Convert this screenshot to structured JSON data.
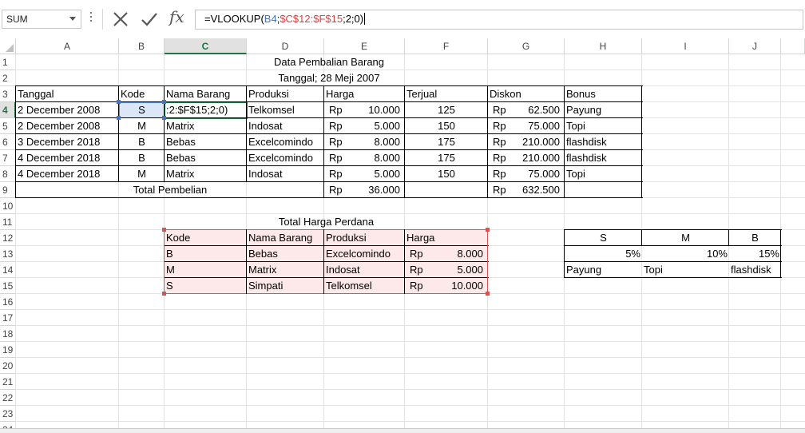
{
  "formula_bar": {
    "name_box": "SUM",
    "formula_prefix": "=VLOOKUP(",
    "formula_ref1": "B4",
    "formula_sep1": ";",
    "formula_ref2": "$C$12:$F$15",
    "formula_suffix": ";2;0)"
  },
  "columns": [
    "A",
    "B",
    "C",
    "D",
    "E",
    "F",
    "G",
    "H",
    "I",
    "J"
  ],
  "rows": [
    "1",
    "2",
    "3",
    "4",
    "5",
    "6",
    "7",
    "8",
    "9",
    "10",
    "11",
    "12",
    "13",
    "14",
    "15",
    "16",
    "17",
    "18",
    "19",
    "20",
    "21",
    "22",
    "23",
    "24"
  ],
  "sheet": {
    "title": "Data Pembalian Barang",
    "date_line": "Tanggal; 28 Meji 2007",
    "headers": [
      "Tanggal",
      "Kode",
      "Nama Barang",
      "Produksi",
      "Harga",
      "Terjual",
      "Diskon",
      "Bonus"
    ],
    "editing_text": ":2:$F$15;2;0)",
    "currency": "Rp",
    "rows": [
      {
        "tanggal": "2 December 2008",
        "kode": "S",
        "nama": "",
        "produksi": "Telkomsel",
        "harga": "10.000",
        "terjual": "125",
        "diskon": "62.500",
        "bonus": "Payung"
      },
      {
        "tanggal": "2 December 2008",
        "kode": "M",
        "nama": "Matrix",
        "produksi": "Indosat",
        "harga": "5.000",
        "terjual": "150",
        "diskon": "75.000",
        "bonus": "Topi"
      },
      {
        "tanggal": "3 December 2018",
        "kode": "B",
        "nama": "Bebas",
        "produksi": "Excelcomindo",
        "harga": "8.000",
        "terjual": "175",
        "diskon": "210.000",
        "bonus": "flashdisk"
      },
      {
        "tanggal": "4 December 2018",
        "kode": "B",
        "nama": "Bebas",
        "produksi": "Excelcomindo",
        "harga": "8.000",
        "terjual": "175",
        "diskon": "210.000",
        "bonus": "flashdisk"
      },
      {
        "tanggal": "4 December 2018",
        "kode": "M",
        "nama": "Matrix",
        "produksi": "Indosat",
        "harga": "5.000",
        "terjual": "150",
        "diskon": "75.000",
        "bonus": "Topi"
      }
    ],
    "total_label": "Total Pembelian",
    "total_harga": "36.000",
    "total_diskon": "632.500",
    "lookup_title": "Total Harga Perdana",
    "lookup_headers": [
      "Kode",
      "Nama Barang",
      "Produksi",
      "Harga"
    ],
    "lookup_rows": [
      {
        "kode": "B",
        "nama": "Bebas",
        "produksi": "Excelcomindo",
        "harga": "8.000"
      },
      {
        "kode": "M",
        "nama": "Matrix",
        "produksi": "Indosat",
        "harga": "5.000"
      },
      {
        "kode": "S",
        "nama": "Simpati",
        "produksi": "Telkomsel",
        "harga": "10.000"
      }
    ],
    "side_headers": [
      "S",
      "M",
      "B"
    ],
    "side_discounts": [
      "5%",
      "10%",
      "15%"
    ],
    "side_bonus": [
      "Payung",
      "Topi",
      "flashdisk"
    ]
  },
  "colors": {
    "excel_green": "#217346",
    "ref_blue": "#4472c4",
    "ref_red": "#e0413f",
    "range_fill": "#fde9e9"
  }
}
